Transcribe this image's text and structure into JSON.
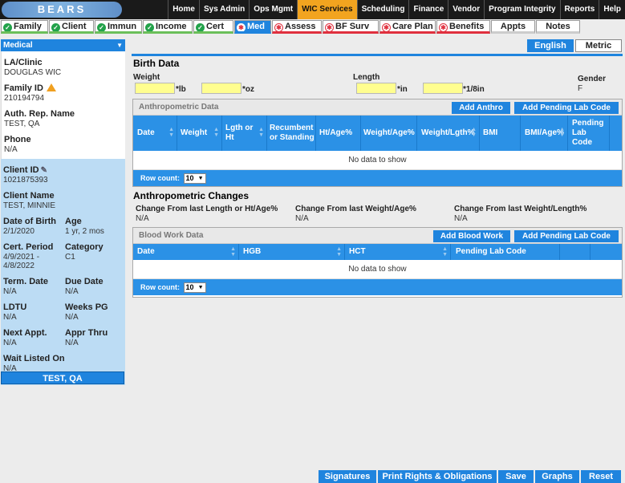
{
  "logo_text": "BEARS",
  "top_menu": [
    "Home",
    "Sys Admin",
    "Ops Mgmt",
    "WIC Services",
    "Scheduling",
    "Finance",
    "Vendor",
    "Program Integrity",
    "Reports",
    "Help"
  ],
  "top_menu_active": "WIC Services",
  "tabs": [
    {
      "label": "Family",
      "status": "ok"
    },
    {
      "label": "Client",
      "status": "ok"
    },
    {
      "label": "Immun",
      "status": "ok"
    },
    {
      "label": "Income",
      "status": "ok"
    },
    {
      "label": "Cert",
      "status": "ok"
    },
    {
      "label": "Med",
      "status": "active"
    },
    {
      "label": "Assess",
      "status": "req"
    },
    {
      "label": "BF Surv",
      "status": "req"
    },
    {
      "label": "Care Plan",
      "status": "req"
    },
    {
      "label": "Benefits",
      "status": "req"
    },
    {
      "label": "Appts",
      "status": "plain"
    },
    {
      "label": "Notes",
      "status": "plain"
    }
  ],
  "program": {
    "selected": "Medical"
  },
  "family": {
    "clinic_label": "LA/Clinic",
    "clinic": "DOUGLAS WIC",
    "family_id_label": "Family ID",
    "family_id": "210194794",
    "auth_rep_label": "Auth. Rep. Name",
    "auth_rep": "TEST, QA",
    "phone_label": "Phone",
    "phone": "N/A"
  },
  "client": {
    "client_id_label": "Client ID",
    "client_id": "1021875393",
    "client_name_label": "Client Name",
    "client_name": "TEST, MINNIE",
    "dob_label": "Date of Birth",
    "dob": "2/1/2020",
    "age_label": "Age",
    "age": "1 yr, 2 mos",
    "cert_period_label": "Cert. Period",
    "cert_period_1": "4/9/2021 -",
    "cert_period_2": "4/8/2022",
    "category_label": "Category",
    "category": "C1",
    "term_date_label": "Term. Date",
    "term_date": "N/A",
    "due_date_label": "Due Date",
    "due_date": "N/A",
    "ldtu_label": "LDTU",
    "ldtu": "N/A",
    "weeks_pg_label": "Weeks PG",
    "weeks_pg": "N/A",
    "next_appt_label": "Next Appt.",
    "next_appt": "N/A",
    "appr_thru_label": "Appr Thru",
    "appr_thru": "N/A",
    "wait_listed_label": "Wait Listed On",
    "wait_listed": "N/A",
    "button": "TEST, QA"
  },
  "lang": {
    "english": "English",
    "metric": "Metric"
  },
  "birth": {
    "title": "Birth Data",
    "weight_label": "Weight",
    "lb_unit": "*lb",
    "oz_unit": "*oz",
    "length_label": "Length",
    "in_unit": "*in",
    "eighth_unit": "*1/8in",
    "gender_label": "Gender",
    "gender": "F",
    "weight_lb": "",
    "weight_oz": "",
    "length_in": "",
    "length_eighth": ""
  },
  "anthro": {
    "title": "Anthropometric Data",
    "add_btn": "Add Anthro",
    "pending_btn": "Add Pending Lab Code",
    "columns": [
      "Date",
      "Weight",
      "Lgth or Ht",
      "Recumbent or Standing",
      "Ht/Age%",
      "Weight/Age%",
      "Weight/Lgth%",
      "BMI",
      "BMI/Age%",
      "Pending Lab Code"
    ],
    "no_data": "No data to show",
    "row_count_label": "Row count:",
    "row_count": "10"
  },
  "changes": {
    "title": "Anthropometric Changes",
    "c1_label": "Change From last Length or Ht/Age%",
    "c1": "N/A",
    "c2_label": "Change From last Weight/Age%",
    "c2": "N/A",
    "c3_label": "Change From last Weight/Length%",
    "c3": "N/A"
  },
  "blood": {
    "title": "Blood Work Data",
    "add_btn": "Add Blood Work",
    "pending_btn": "Add Pending Lab Code",
    "columns": [
      "Date",
      "HGB",
      "HCT",
      "Pending Lab Code"
    ],
    "no_data": "No data to show",
    "row_count_label": "Row count:",
    "row_count": "10"
  },
  "footer": [
    "Signatures",
    "Print Rights & Obligations",
    "Save",
    "Graphs",
    "Reset"
  ],
  "colors": {
    "accent": "#1f84de",
    "active_menu": "#f2a41f",
    "ok": "#22a24a",
    "required": "#e0303e",
    "input": "#fffe8f",
    "client_panel": "#bcdcf4"
  }
}
